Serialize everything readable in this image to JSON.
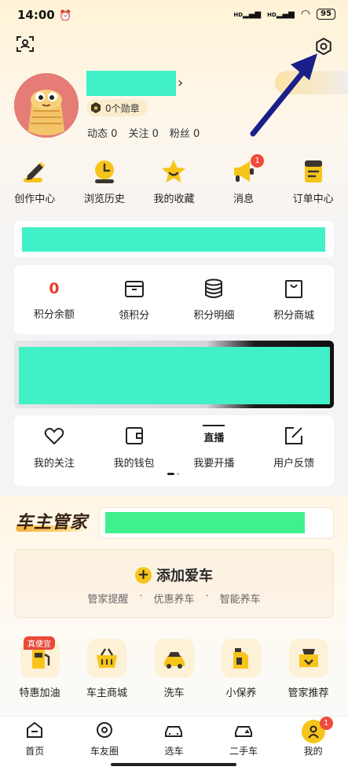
{
  "status_bar": {
    "time": "14:00",
    "network1": "HD",
    "network2": "HD",
    "battery": "95"
  },
  "profile": {
    "badge_count": "0个勋章",
    "stats": [
      {
        "label": "动态",
        "value": "0"
      },
      {
        "label": "关注",
        "value": "0"
      },
      {
        "label": "粉丝",
        "value": "0"
      }
    ]
  },
  "quick_actions": [
    {
      "label": "创作中心",
      "icon": "pencil-icon"
    },
    {
      "label": "浏览历史",
      "icon": "clock-icon"
    },
    {
      "label": "我的收藏",
      "icon": "star-icon"
    },
    {
      "label": "消息",
      "icon": "megaphone-icon",
      "badge": "1"
    },
    {
      "label": "订单中心",
      "icon": "order-icon"
    }
  ],
  "points": [
    {
      "value": "0",
      "label": "积分余额"
    },
    {
      "label": "领积分",
      "icon": "box-icon"
    },
    {
      "label": "积分明细",
      "icon": "database-icon"
    },
    {
      "label": "积分商城",
      "icon": "shopping-bag-icon"
    }
  ],
  "services": [
    {
      "label": "我的关注",
      "icon": "heart-icon"
    },
    {
      "label": "我的钱包",
      "icon": "wallet-icon"
    },
    {
      "label": "我要开播",
      "icon": "live-icon",
      "icon_text": "直播"
    },
    {
      "label": "用户反馈",
      "icon": "edit-icon"
    }
  ],
  "car_butler": {
    "title": "车主管家",
    "add_car": "添加爱车",
    "features": [
      "管家提醒",
      "·",
      "优惠养车",
      "·",
      "智能养车"
    ]
  },
  "bottom_services": [
    {
      "label": "特惠加油",
      "icon": "fuel-icon",
      "tag": "真便宜"
    },
    {
      "label": "车主商城",
      "icon": "basket-icon"
    },
    {
      "label": "洗车",
      "icon": "car-wash-icon"
    },
    {
      "label": "小保养",
      "icon": "oil-icon"
    },
    {
      "label": "管家推荐",
      "icon": "recommend-icon"
    }
  ],
  "nav": [
    {
      "label": "首页",
      "icon": "home-icon"
    },
    {
      "label": "车友圈",
      "icon": "community-icon"
    },
    {
      "label": "选车",
      "icon": "car-icon"
    },
    {
      "label": "二手车",
      "icon": "used-car-icon"
    },
    {
      "label": "我的",
      "icon": "me-icon",
      "badge": "1",
      "active": true
    }
  ],
  "colors": {
    "accent": "#f7c51a",
    "badge_red": "#f24a3a",
    "points_red": "#e8402f",
    "redaction": "#40f0c6",
    "arrow": "#1a1f8a"
  }
}
